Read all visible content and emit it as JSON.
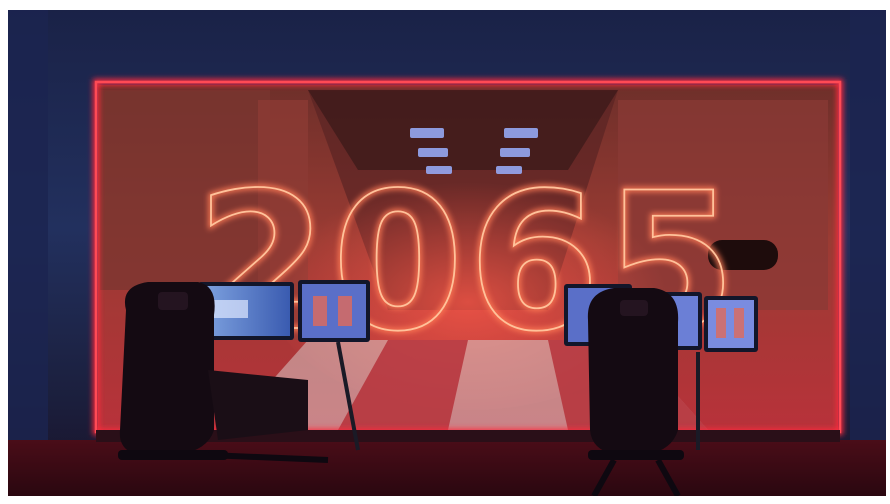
{
  "scene": {
    "neon_text": "2065",
    "colors": {
      "wall": "#22305e",
      "neon_frame": "#ff2b3d",
      "neon_text": "#ffb28a",
      "floor": "#3a0a14",
      "backdrop": "#8a2a2a"
    }
  }
}
